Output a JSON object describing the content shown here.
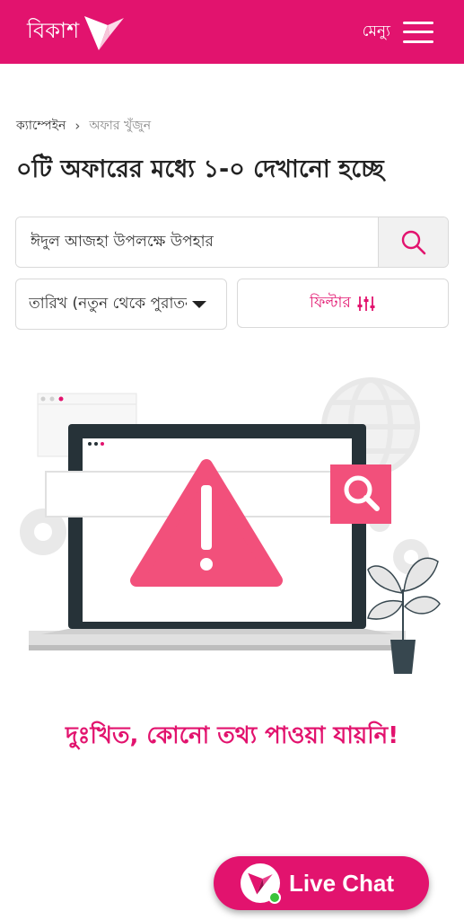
{
  "header": {
    "logo_text": "বিকাশ",
    "menu_label": "মেন্যু"
  },
  "breadcrumb": {
    "home": "ক্যাম্পেইন",
    "separator": "›",
    "current": "অফার খুঁজুন"
  },
  "title": "০টি অফারের মধ্যে ১-০ দেখানো হচ্ছে",
  "search": {
    "value": "ঈদুল আজহা উপলক্ষে উপহার",
    "icon": "search-icon"
  },
  "sort": {
    "selected": "তারিখ (নতুন থেকে পুরাতন)"
  },
  "filter": {
    "label": "ফিল্টার"
  },
  "empty_state": {
    "message": "দুঃখিত, কোনো তথ্য পাওয়া যায়নি!"
  },
  "live_chat": {
    "label": "Live Chat"
  },
  "colors": {
    "brand": "#E2136E",
    "text": "#222222",
    "muted": "#888888"
  }
}
